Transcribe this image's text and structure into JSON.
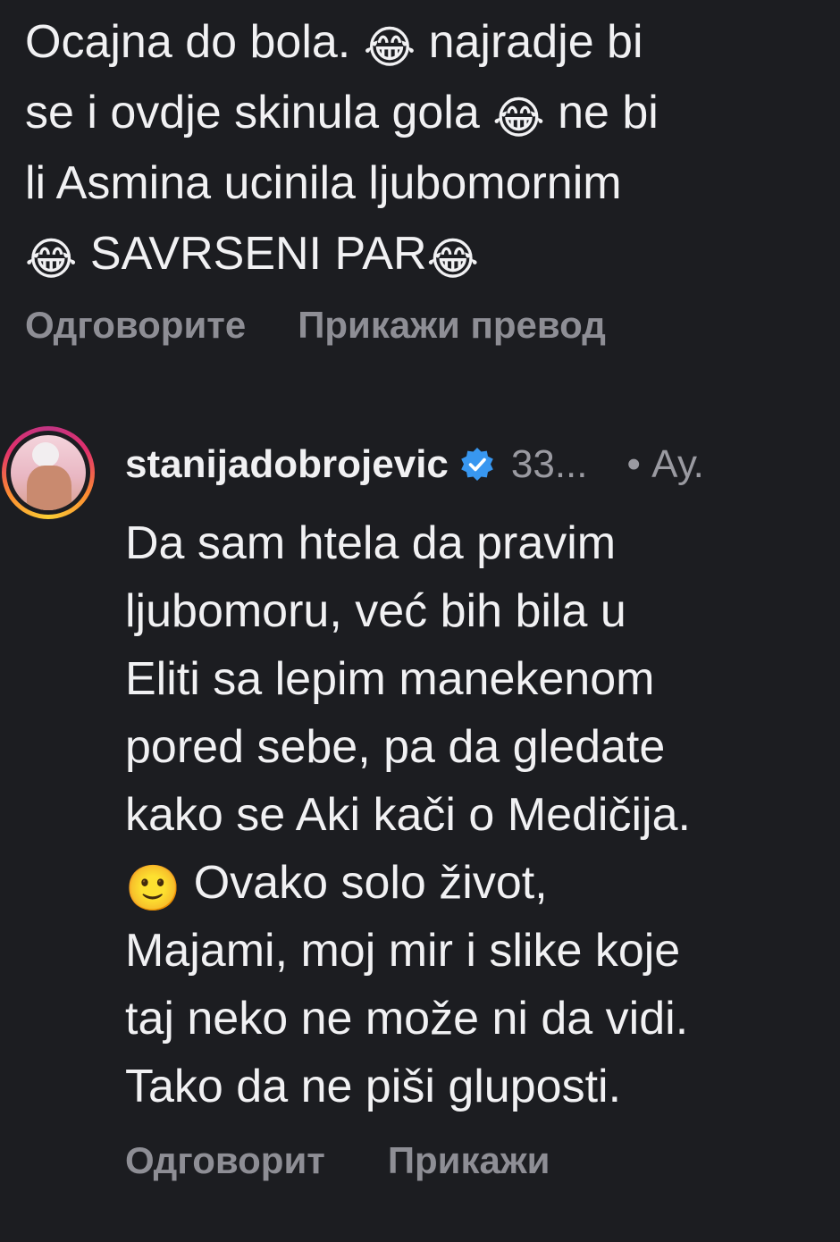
{
  "first_comment": {
    "lines": [
      {
        "before": "Ocajna do bola. ",
        "emoji": "😂",
        "after": " najradje bi"
      },
      {
        "before": "se i ovdje skinula gola ",
        "emoji": "😂",
        "after": " ne bi"
      },
      {
        "before": "li Asmina ucinila ljubomornim",
        "emoji": "",
        "after": ""
      },
      {
        "before": "",
        "emoji": "😂",
        "after": " SAVRSENI PAR",
        "emoji2": "😂"
      }
    ],
    "reply_label": "Одговорите",
    "translate_label": "Прикажи превод"
  },
  "reply_comment": {
    "username": "stanijadobrojevic",
    "verified_icon": "verified-badge-icon",
    "verified_color": "#3897f0",
    "meta_time": "33...",
    "meta_extra": "• Ау.",
    "lines": [
      {
        "before": "Da sam htela da pravim",
        "emoji": "",
        "after": ""
      },
      {
        "before": "ljubomoru, već bih bila u",
        "emoji": "",
        "after": ""
      },
      {
        "before": "Eliti sa lepim manekenom",
        "emoji": "",
        "after": ""
      },
      {
        "before": "pored sebe, pa da gledate",
        "emoji": "",
        "after": ""
      },
      {
        "before": "kako se Aki kači o Medičija.",
        "emoji": "",
        "after": ""
      },
      {
        "before": "",
        "emoji": "🙂",
        "after": " Ovako solo život,"
      },
      {
        "before": "Majami, moj mir i slike koje",
        "emoji": "",
        "after": ""
      },
      {
        "before": "taj neko ne može ni da vidi.",
        "emoji": "",
        "after": ""
      },
      {
        "before": "Tako da ne piši gluposti.",
        "emoji": "",
        "after": ""
      }
    ],
    "reply_label": "Одговорит",
    "translate_label": "Прикажи"
  }
}
